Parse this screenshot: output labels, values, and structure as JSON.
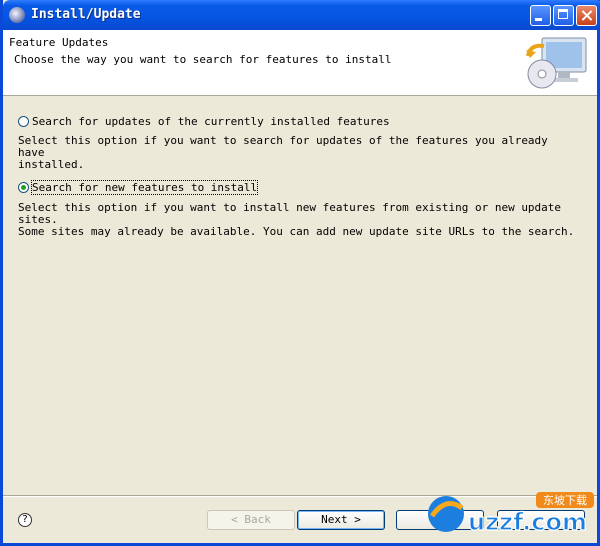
{
  "window": {
    "title": "Install/Update"
  },
  "header": {
    "title": "Feature Updates",
    "description": "Choose the way you want to search for features to install"
  },
  "options": [
    {
      "label": "Search for updates of the currently installed features",
      "description_line1": "Select this option if you want to search for updates of the features you already have",
      "description_line2": "installed.",
      "selected": false
    },
    {
      "label": "Search for new features to install",
      "description_line1": "Select this option if you want to install new features from existing or new update sites.",
      "description_line2": "Some sites may already be available. You can add new update site URLs to the search.",
      "selected": true
    }
  ],
  "buttons": {
    "help": "?",
    "back": "< Back",
    "next": "Next >",
    "finish": "",
    "cancel": ""
  },
  "watermark": {
    "text": "uzzf.com",
    "badge": "东坡下载"
  }
}
